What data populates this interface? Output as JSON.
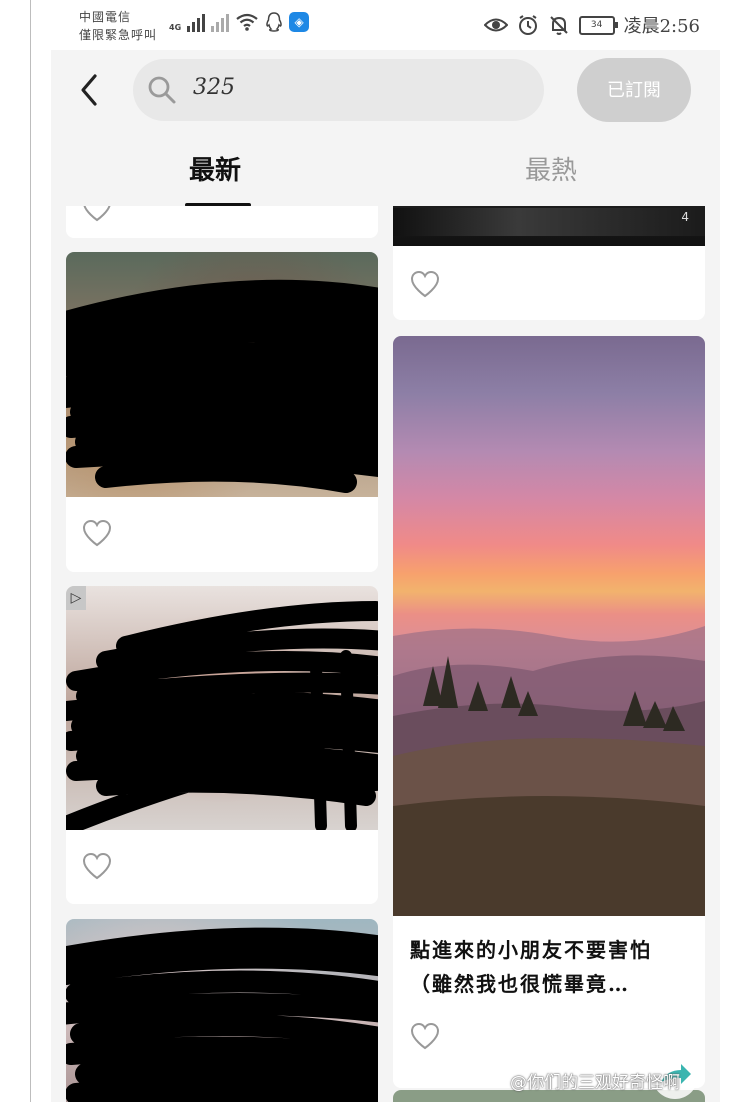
{
  "status_bar": {
    "carrier_line1": "中國電信",
    "carrier_line2": "僅限緊急呼叫",
    "network_type": "4G",
    "battery": "34",
    "time": "凌晨2:56",
    "icons": [
      "signal-icon",
      "no-signal-icon",
      "wifi-icon",
      "qq-icon",
      "shield-app-icon",
      "eye-icon",
      "alarm-icon",
      "bell-off-icon",
      "battery-icon"
    ]
  },
  "header": {
    "search_query": "325",
    "subscribe_label": "已訂閱"
  },
  "tabs": [
    {
      "label": "最新",
      "active": true
    },
    {
      "label": "最熱",
      "active": false
    }
  ],
  "feed": {
    "right_top_badge": "4",
    "sunset_post_caption": "點進來的小朋友不要害怕（雖然我也很慌畢竟…"
  },
  "watermark": "@你们的三观好奇怪啊",
  "colors": {
    "accent": "#111111",
    "subscribe_bg": "#cfcfcf",
    "search_bg": "#e8e8e8",
    "app_bg": "#f4f4f4",
    "fab": "#3ab5b0"
  }
}
